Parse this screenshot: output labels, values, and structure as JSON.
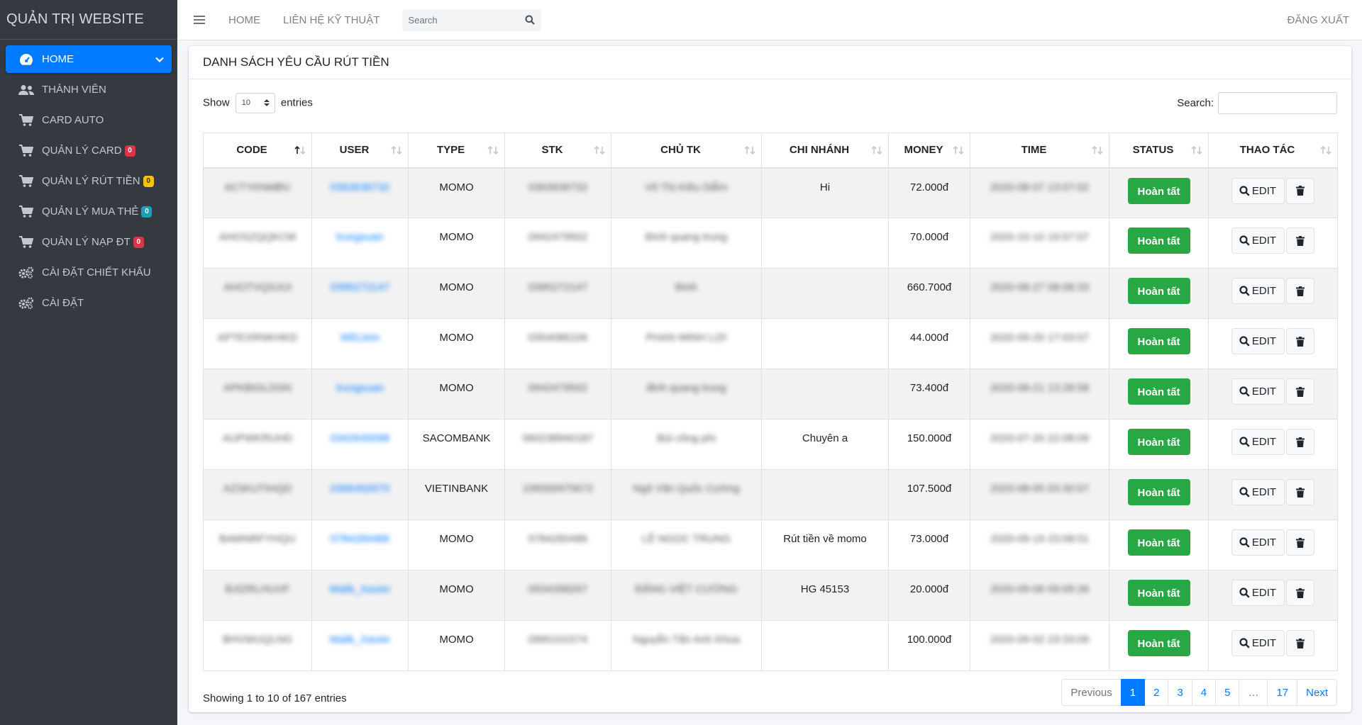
{
  "sidebar": {
    "brand": "QUẢN TRỊ WEBSITE",
    "items": [
      {
        "label": "HOME",
        "icon": "dashboard-icon",
        "active": true
      },
      {
        "label": "THÀNH VIÊN",
        "icon": "users-icon"
      },
      {
        "label": "CARD AUTO",
        "icon": "cart-icon"
      },
      {
        "label": "QUẢN LÝ CARD",
        "icon": "cart-icon",
        "badge": "0",
        "badge_color": "#dc3545"
      },
      {
        "label": "QUẢN LÝ RÚT TIỀN",
        "icon": "cart-icon",
        "badge": "0",
        "badge_color": "#ffc107"
      },
      {
        "label": "QUẢN LÝ MUA THẺ",
        "icon": "cart-icon",
        "badge": "0",
        "badge_color": "#17a2b8"
      },
      {
        "label": "QUẢN LÝ NẠP ĐT",
        "icon": "cart-icon",
        "badge": "0",
        "badge_color": "#dc3545"
      },
      {
        "label": "CÀI ĐẶT CHIẾT KHẤU",
        "icon": "cogs-icon"
      },
      {
        "label": "CÀI ĐẶT",
        "icon": "cogs-icon"
      }
    ]
  },
  "topbar": {
    "menu_icon": "hamburger-icon",
    "links": [
      "HOME",
      "LIÊN HỆ KỸ THUẬT"
    ],
    "search_placeholder": "Search",
    "logout": "ĐĂNG XUẤT"
  },
  "card": {
    "title": "DANH SÁCH YÊU CẦU RÚT TIỀN",
    "show_label": "Show",
    "entries_value": "10",
    "entries_label": "entries",
    "search_label": "Search:",
    "columns": [
      "CODE",
      "USER",
      "TYPE",
      "STK",
      "CHỦ TK",
      "CHI NHÁNH",
      "MONEY",
      "TIME",
      "STATUS",
      "THAO TÁC"
    ],
    "rows": [
      {
        "code": "ACTYKNMBV",
        "user": "0363636732",
        "type": "MOMO",
        "stk": "0363636732",
        "owner": "Võ Thị Kiều Diễm",
        "branch": "Hi",
        "money": "72.000đ",
        "time": "2020-08-07 13:07:02"
      },
      {
        "code": "AHOSZQQKCM",
        "user": "trungxuan",
        "type": "MOMO",
        "stk": "0942479502",
        "owner": "Đinh quang trung",
        "branch": "",
        "money": "70.000đ",
        "time": "2020-10-10 19:57:07"
      },
      {
        "code": "AHOTVQSJUI",
        "user": "0395272147",
        "type": "MOMO",
        "stk": "0395272147",
        "owner": "Đinh",
        "branch": "",
        "money": "660.700đ",
        "time": "2020-08-27 08:08:33"
      },
      {
        "code": "APTEXRNKHKD",
        "user": "WELkim",
        "type": "MOMO",
        "stk": "0354086106",
        "owner": "PHAN MINH LỢI",
        "branch": "",
        "money": "44.000đ",
        "time": "2020-09-20 17:03:07"
      },
      {
        "code": "APKBIGLDSN",
        "user": "trungxuan",
        "type": "MOMO",
        "stk": "0942479502",
        "owner": "đinh quang trung",
        "branch": "",
        "money": "73.400đ",
        "time": "2020-08-21 13:28:58"
      },
      {
        "code": "AUPWKRUHD",
        "user": "0342645098",
        "type": "SACOMBANK",
        "stk": "060238940187",
        "owner": "Bùi công phi",
        "branch": "Chuyên a",
        "money": "150.000đ",
        "time": "2020-07-20 22:08:09"
      },
      {
        "code": "AZSKUTIHQD",
        "user": "0366492670",
        "type": "VIETINBANK",
        "stk": "106000975672",
        "owner": "Ngô Văn Quốc Cường",
        "branch": "",
        "money": "107.500đ",
        "time": "2020-08-05 03:30:07"
      },
      {
        "code": "BAWNRFYHQU",
        "user": "0784260486",
        "type": "MOMO",
        "stk": "0784260486",
        "owner": "LÊ NGỌC TRUNG",
        "branch": "Rút tiền về momo",
        "money": "73.000đ",
        "time": "2020-09-19 23:08:51"
      },
      {
        "code": "BJIZRLHUVF",
        "user": "Malik_Xavier",
        "type": "MOMO",
        "stk": "0934268267",
        "owner": "ĐẶNG VIỆT CƯỜNG",
        "branch": "HG 45153",
        "money": "20.000đ",
        "time": "2020-09-06 09:09:26"
      },
      {
        "code": "BHVWUQLNG",
        "user": "Malik_Xavier",
        "type": "MOMO",
        "stk": "0965101574",
        "owner": "Nguyễn Tấn Anh Khoa",
        "branch": "",
        "money": "100.000đ",
        "time": "2020-09-02 23:33:09"
      }
    ],
    "status_label": "Hoàn tất",
    "edit_label": "EDIT",
    "info": "Showing 1 to 10 of 167 entries",
    "pagination": [
      "Previous",
      "1",
      "2",
      "3",
      "4",
      "5",
      "…",
      "17",
      "Next"
    ],
    "active_page": "1",
    "colors": {
      "primary": "#007bff",
      "success": "#28a745",
      "sidebar_bg": "#343a40"
    }
  }
}
